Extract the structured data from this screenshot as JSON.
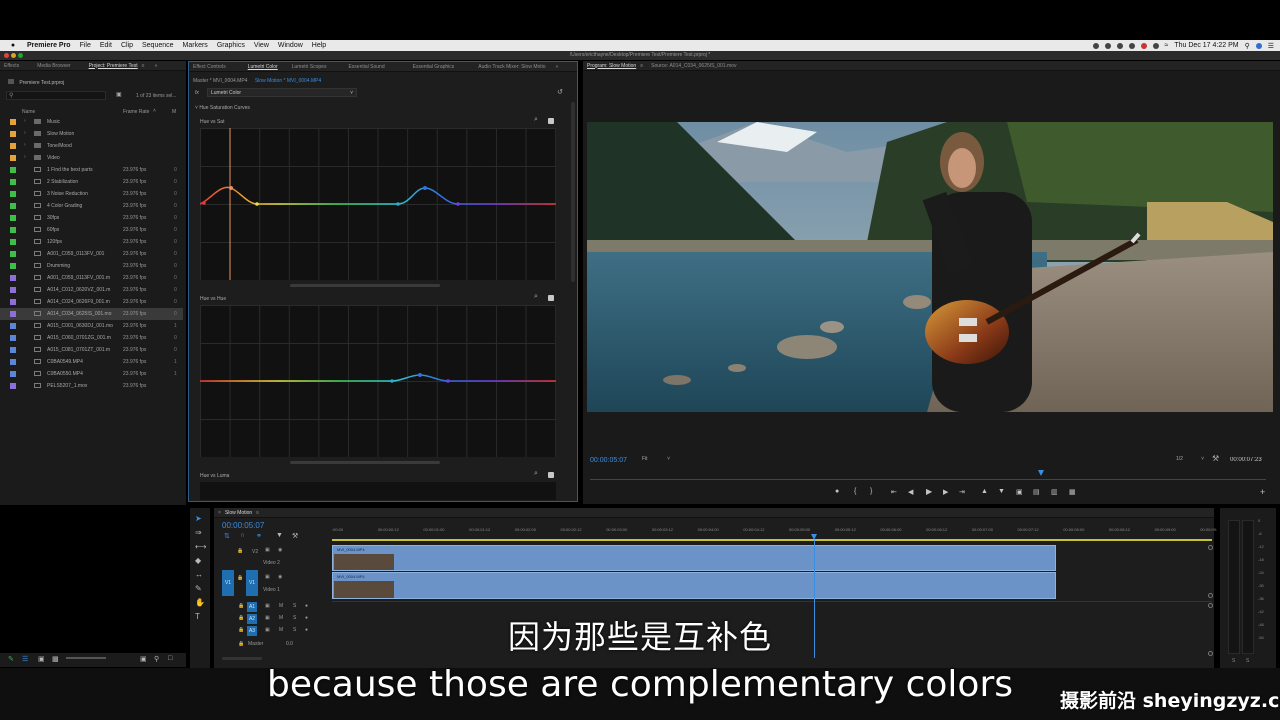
{
  "menubar": {
    "app_name": "Premiere Pro",
    "items": [
      "File",
      "Edit",
      "Clip",
      "Sequence",
      "Markers",
      "Graphics",
      "View",
      "Window",
      "Help"
    ],
    "clock": "Thu Dec 17  4:22 PM"
  },
  "window": {
    "title": "/Users/ericthayne/Desktop/Premiere Test/Premiere Test.prproj *"
  },
  "project_panel": {
    "tabs": [
      "Effects",
      "Media Browser",
      "Project: Premiere Test"
    ],
    "project_file": "Premiere Test.prproj",
    "items_count": "1 of 23 items sel...",
    "col_name": "Name",
    "col_framerate": "Frame Rate",
    "rows": [
      {
        "name": "Music",
        "fps": "",
        "ex": "",
        "color": "#e8a23a",
        "folder": true
      },
      {
        "name": "Slow Motion",
        "fps": "",
        "ex": "",
        "color": "#e8a23a",
        "folder": true
      },
      {
        "name": "Tone/Mood",
        "fps": "",
        "ex": "",
        "color": "#e8a23a",
        "folder": true
      },
      {
        "name": "Video",
        "fps": "",
        "ex": "",
        "color": "#e8a23a",
        "folder": true
      },
      {
        "name": "1 Find the best parts",
        "fps": "23.976 fps",
        "ex": "0",
        "color": "#3fbf4a",
        "folder": false
      },
      {
        "name": "2 Stabilization",
        "fps": "23.976 fps",
        "ex": "0",
        "color": "#3fbf4a",
        "folder": false
      },
      {
        "name": "3 Noise Reduction",
        "fps": "23.976 fps",
        "ex": "0",
        "color": "#3fbf4a",
        "folder": false
      },
      {
        "name": "4 Color Grading",
        "fps": "23.976 fps",
        "ex": "0",
        "color": "#3fbf4a",
        "folder": false
      },
      {
        "name": "30fps",
        "fps": "23.976 fps",
        "ex": "0",
        "color": "#3fbf4a",
        "folder": false
      },
      {
        "name": "60fps",
        "fps": "23.976 fps",
        "ex": "0",
        "color": "#3fbf4a",
        "folder": false
      },
      {
        "name": "120fps",
        "fps": "23.976 fps",
        "ex": "0",
        "color": "#3fbf4a",
        "folder": false
      },
      {
        "name": "A001_C059_0113FV_001",
        "fps": "23.976 fps",
        "ex": "0",
        "color": "#3fbf4a",
        "folder": false
      },
      {
        "name": "Drumming",
        "fps": "23.976 fps",
        "ex": "0",
        "color": "#3fbf4a",
        "folder": false
      },
      {
        "name": "A001_C059_0113FV_001.m",
        "fps": "23.976 fps",
        "ex": "0",
        "color": "#8e6fd6",
        "folder": false
      },
      {
        "name": "A014_C012_0620VZ_001.m",
        "fps": "23.976 fps",
        "ex": "0",
        "color": "#8e6fd6",
        "folder": false
      },
      {
        "name": "A014_C024_0626F9_001.m",
        "fps": "23.976 fps",
        "ex": "0",
        "color": "#8e6fd6",
        "folder": false
      },
      {
        "name": "A014_C034_0625IS_001.mo",
        "fps": "23.976 fps",
        "ex": "0",
        "color": "#8e6fd6",
        "folder": false
      },
      {
        "name": "A015_C001_0630DJ_001.mo",
        "fps": "23.976 fps",
        "ex": "1",
        "color": "#5a86d8",
        "folder": false
      },
      {
        "name": "A015_C060_0701ZG_001.m",
        "fps": "23.976 fps",
        "ex": "0",
        "color": "#5a86d8",
        "folder": false
      },
      {
        "name": "A015_C081_0701ZT_001.m",
        "fps": "23.976 fps",
        "ex": "0",
        "color": "#5a86d8",
        "folder": false
      },
      {
        "name": "C0BA0549.MP4",
        "fps": "23.976 fps",
        "ex": "1",
        "color": "#5a86d8",
        "folder": false
      },
      {
        "name": "C0BA0550.MP4",
        "fps": "23.976 fps",
        "ex": "1",
        "color": "#5a86d8",
        "folder": false
      },
      {
        "name": "PELS5207_1.mov",
        "fps": "23.976 fps",
        "ex": "",
        "color": "#8e6fd6",
        "folder": false
      }
    ]
  },
  "effect_panel": {
    "tabs": [
      "Effect Controls",
      "Lumetri Color",
      "Lumetri Scopes",
      "Essential Sound",
      "Essential Graphics",
      "Audio Track Mixer: Slow Motio"
    ],
    "master_clip": "Master * MVI_0004.MP4",
    "seq_clip": "Slow Motion * MVI_0004.MP4",
    "effect_name": "Lumetri Color",
    "section": "Hue Saturation Curves",
    "curve1": "Hue vs Sat",
    "curve2": "Hue vs Hue",
    "curve3": "Hue vs Luma"
  },
  "program_monitor": {
    "tab": "Program: Slow Motion",
    "source_tab": "Source: A014_C034_0625IS_001.mov",
    "timecode": "00:00:05:07",
    "fit": "Fit",
    "quality": "1/2",
    "duration": "00:00:07:23"
  },
  "timeline": {
    "tab": "Slow Motion",
    "timecode": "00:00:05:07",
    "ruler": [
      ":00:00",
      "00:00:00:12",
      "00:00:01:00",
      "00:00:01:12",
      "00:00:02:00",
      "00:00:02:12",
      "00:00:03:00",
      "00:00:03:12",
      "00:00:04:00",
      "00:00:04:12",
      "00:00:05:00",
      "00:00:05:12",
      "00:00:06:00",
      "00:00:06:12",
      "00:00:07:00",
      "00:00:07:12",
      "00:00:08:00",
      "00:00:08:12",
      "00:00:09:00",
      "00:00:09:"
    ],
    "v2": "V2",
    "v1": "V1",
    "a1": "A1",
    "a2": "A2",
    "a3": "A3",
    "video2": "Video 2",
    "video1": "Video 1",
    "clip_v2": "MVI_0004.MP4",
    "clip_v1": "MVI_0004.MP4",
    "master": "Master",
    "master_val": "0.0",
    "m": "M",
    "s": "S"
  },
  "meter_ticks": [
    "0",
    "-6",
    "-12",
    "-18",
    "-24",
    "-30",
    "-36",
    "-42",
    "-48",
    "-54"
  ],
  "subtitles": {
    "zh": "因为那些是互补色",
    "en": "because those are complementary colors"
  },
  "watermark": "摄影前沿 sheyingzyz.com"
}
